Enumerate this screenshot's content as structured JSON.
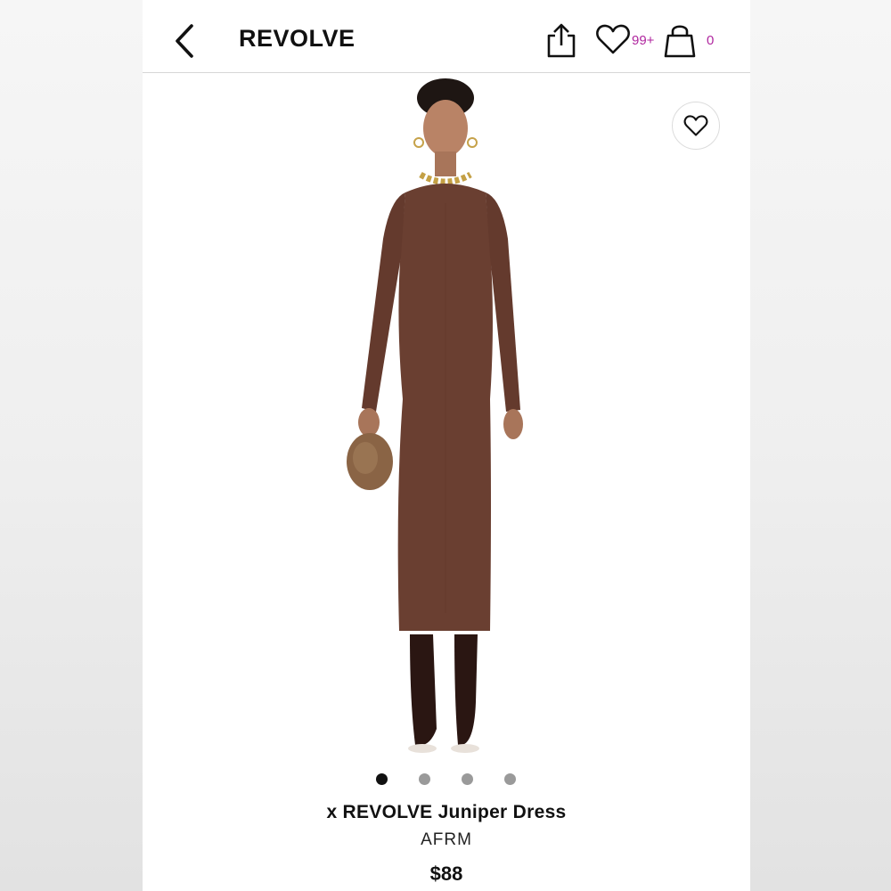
{
  "header": {
    "brand": "REVOLVE",
    "wishlist_count": "99+",
    "bag_count": "0",
    "icons": [
      "back-arrow-icon",
      "share-icon",
      "heart-icon",
      "shopping-bag-icon"
    ]
  },
  "product": {
    "title": "x REVOLVE Juniper Dress",
    "brand": "AFRM",
    "price": "$88",
    "image_alt": "Model wearing brown long-sleeve midi dress",
    "image_count": 4,
    "active_image_index": 0,
    "dress_color": "#6a3f31"
  },
  "colors": {
    "accent": "#b0279f",
    "text": "#111111"
  }
}
